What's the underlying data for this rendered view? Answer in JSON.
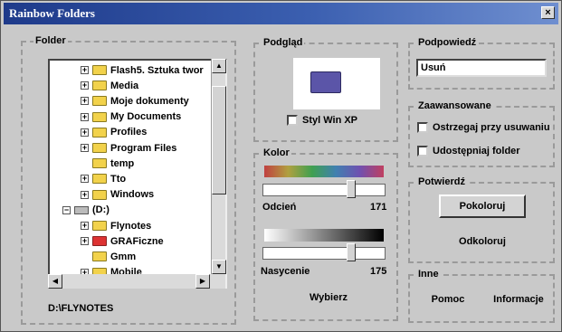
{
  "window": {
    "title": "Rainbow Folders",
    "close": "×"
  },
  "folder_panel": {
    "label": "Folder",
    "items": [
      {
        "name": "Flash5. Sztuka twor",
        "expander": "+",
        "icon": "folder"
      },
      {
        "name": "Media",
        "expander": "+",
        "icon": "folder"
      },
      {
        "name": "Moje dokumenty",
        "expander": "+",
        "icon": "folder"
      },
      {
        "name": "My Documents",
        "expander": "+",
        "icon": "folder"
      },
      {
        "name": "Profiles",
        "expander": "+",
        "icon": "folder"
      },
      {
        "name": "Program Files",
        "expander": "+",
        "icon": "folder"
      },
      {
        "name": "temp",
        "expander": "",
        "icon": "folder"
      },
      {
        "name": "Tto",
        "expander": "+",
        "icon": "folder"
      },
      {
        "name": "Windows",
        "expander": "+",
        "icon": "folder"
      },
      {
        "name": "(D:)",
        "expander": "−",
        "icon": "drive"
      },
      {
        "name": "Flynotes",
        "expander": "+",
        "icon": "folder"
      },
      {
        "name": "GRAFiczne",
        "expander": "+",
        "icon": "folder-red"
      },
      {
        "name": "Gmm",
        "expander": "",
        "icon": "folder"
      },
      {
        "name": "Mobile",
        "expander": "+",
        "icon": "folder"
      }
    ],
    "path": "D:\\FLYNOTES"
  },
  "preview_panel": {
    "label": "Podgląd",
    "checkbox_label": "Styl Win XP"
  },
  "color_panel": {
    "label": "Kolor",
    "hue_label": "Odcień",
    "hue_value": "171",
    "saturation_label": "Nasycenie",
    "saturation_value": "175",
    "choose_button": "Wybierz"
  },
  "hint_panel": {
    "label": "Podpowiedź",
    "input_value": "Usuń"
  },
  "advanced_panel": {
    "label": "Zaawansowane",
    "warn_delete": "Ostrzegaj przy usuwaniu",
    "share_folder": "Udostępniaj folder"
  },
  "confirm_panel": {
    "label": "Potwierdź",
    "colorize_button": "Pokoloruj",
    "uncolorize_button": "Odkoloruj"
  },
  "other_panel": {
    "label": "Inne",
    "help_button": "Pomoc",
    "info_button": "Informacje"
  }
}
